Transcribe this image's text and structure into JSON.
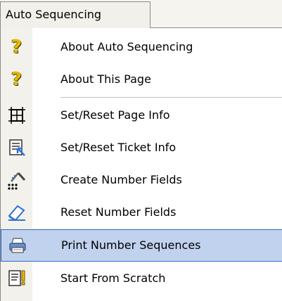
{
  "menu": {
    "title": "Auto Sequencing",
    "items": [
      {
        "label": "About Auto Sequencing",
        "icon": "help-icon"
      },
      {
        "label": "About This Page",
        "icon": "help-icon"
      },
      {
        "label": "Set/Reset Page Info",
        "icon": "page-frame-icon"
      },
      {
        "label": "Set/Reset Ticket Info",
        "icon": "ticket-info-icon"
      },
      {
        "label": "Create Number Fields",
        "icon": "create-fields-icon"
      },
      {
        "label": "Reset Number Fields",
        "icon": "eraser-icon"
      },
      {
        "label": "Print Number Sequences",
        "icon": "printer-icon",
        "highlighted": true
      },
      {
        "label": "Start From Scratch",
        "icon": "document-warning-icon"
      }
    ]
  },
  "colors": {
    "highlight_fill": "#c1d2ee",
    "highlight_border": "#316ac5",
    "gutter": "#f3f1eb"
  }
}
